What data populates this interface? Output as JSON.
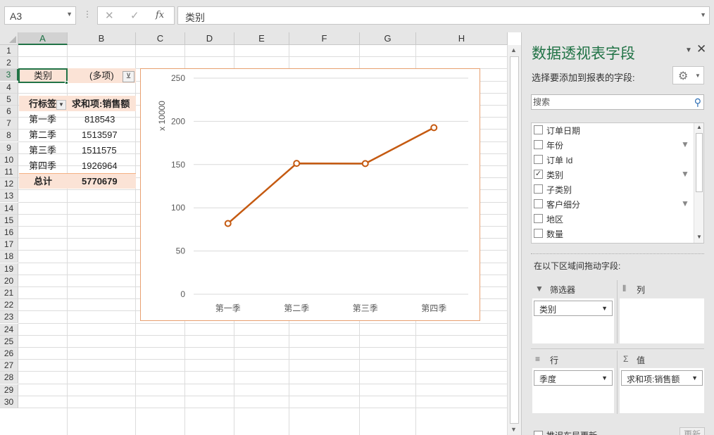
{
  "formula_bar": {
    "name_box": "A3",
    "formula": "类别",
    "fx_label": "fx"
  },
  "sheet": {
    "columns": [
      "A",
      "B",
      "C",
      "D",
      "E",
      "F",
      "G",
      "H"
    ],
    "rows": [
      "1",
      "2",
      "3",
      "4",
      "5",
      "6",
      "7",
      "8",
      "9",
      "10",
      "11",
      "12",
      "13",
      "14",
      "15",
      "16",
      "17",
      "18",
      "19",
      "20",
      "21",
      "22",
      "23",
      "24",
      "25",
      "26",
      "27",
      "28",
      "29",
      "30"
    ],
    "active_column": "A",
    "active_row": "3",
    "pivot": {
      "filter_label": "类别",
      "filter_value": "(多项)",
      "row_header": "行标签",
      "value_header": "求和项:销售额",
      "rows": [
        {
          "label": "第一季",
          "value": "818543"
        },
        {
          "label": "第二季",
          "value": "1513597"
        },
        {
          "label": "第三季",
          "value": "1511575"
        },
        {
          "label": "第四季",
          "value": "1926964"
        }
      ],
      "total_label": "总计",
      "total_value": "5770679"
    }
  },
  "chart_data": {
    "type": "line",
    "title": "",
    "categories": [
      "第一季",
      "第二季",
      "第三季",
      "第四季"
    ],
    "series": [
      {
        "name": "",
        "values": [
          81.8543,
          151.3597,
          151.1575,
          192.6964
        ],
        "color": "#c55a11"
      }
    ],
    "ylabel": "x 10000",
    "ylim": [
      0,
      250
    ],
    "yticks": [
      0,
      50,
      100,
      150,
      200,
      250
    ],
    "grid": true,
    "legend": "none"
  },
  "pane": {
    "title": "数据透视表字段",
    "subtitle": "选择要添加到报表的字段:",
    "search_placeholder": "搜索",
    "fields": [
      {
        "label": "订单日期",
        "checked": false,
        "filtered": false
      },
      {
        "label": "年份",
        "checked": false,
        "filtered": true
      },
      {
        "label": "订单 Id",
        "checked": false,
        "filtered": false
      },
      {
        "label": "类别",
        "checked": true,
        "filtered": true
      },
      {
        "label": "子类别",
        "checked": false,
        "filtered": false
      },
      {
        "label": "客户细分",
        "checked": false,
        "filtered": true
      },
      {
        "label": "地区",
        "checked": false,
        "filtered": false
      },
      {
        "label": "数量",
        "checked": false,
        "filtered": false
      }
    ],
    "drag_hint": "在以下区域间拖动字段:",
    "areas": {
      "filters_title": "筛选器",
      "columns_title": "列",
      "rows_title": "行",
      "values_title": "值",
      "filters_field": "类别",
      "rows_field": "季度",
      "values_field": "求和项:销售额"
    },
    "defer_label": "推迟布局更新",
    "update_label": "更新"
  },
  "colors": {
    "accent": "#217346",
    "pivot_header_bg": "#fbe3d6",
    "series": "#c55a11",
    "chart_border": "#e8a070"
  },
  "icons": {
    "filter_button": "filter-icon",
    "search": "search-icon",
    "gear": "gear-icon",
    "close": "close-icon"
  }
}
